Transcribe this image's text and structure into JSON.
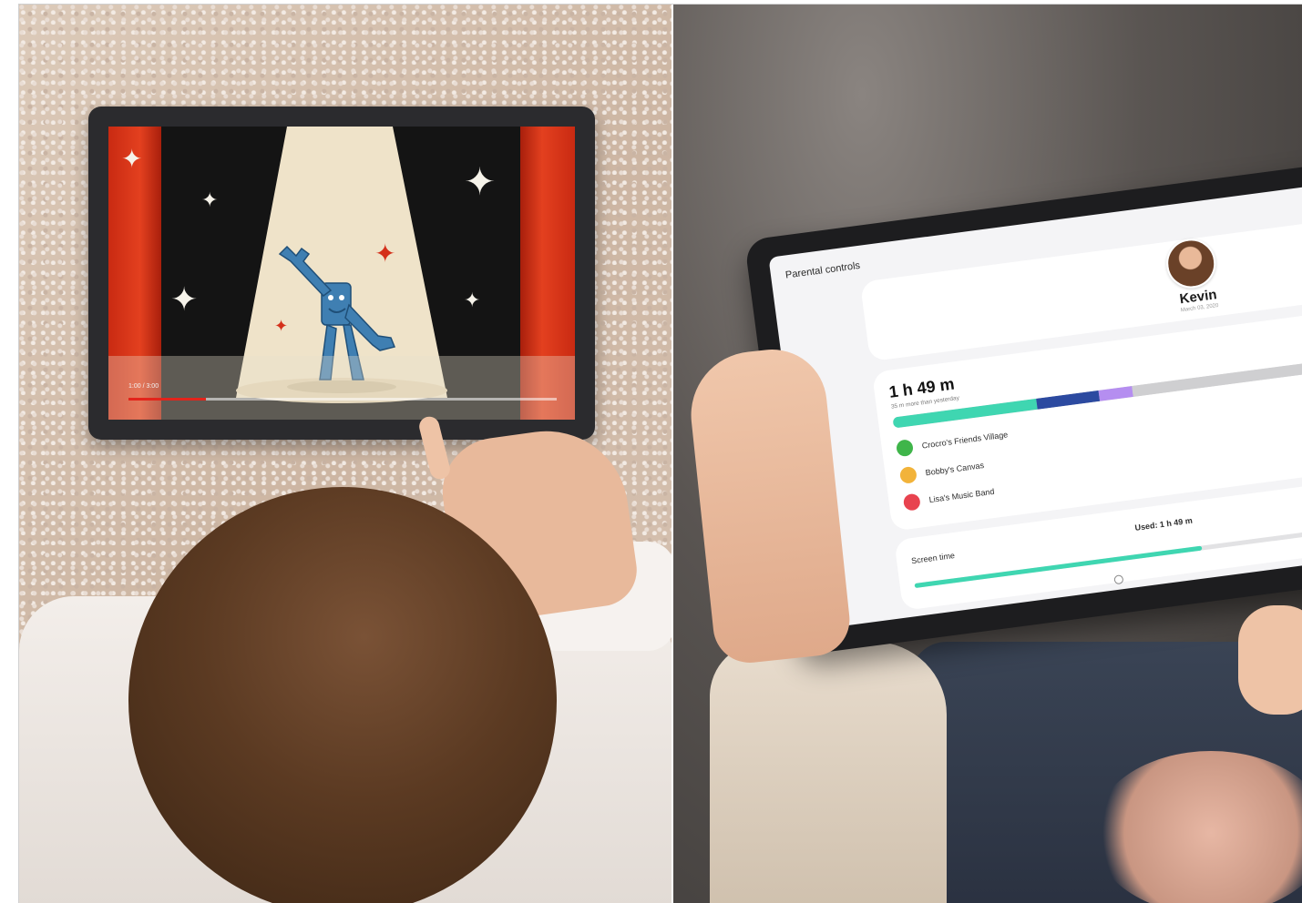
{
  "left_panel": {
    "video": {
      "time_label": "1:00 / 3:00",
      "progress_fraction": 0.18
    }
  },
  "right_panel": {
    "parental_controls": {
      "title": "Parental controls",
      "child": {
        "name": "Kevin",
        "date": "March 03, 2020"
      },
      "usage": {
        "total": "1 h 49 m",
        "comparison": "35 m more than yesterday",
        "segments": [
          {
            "fraction": 0.3,
            "color": "#3fd6b1"
          },
          {
            "fraction": 0.13,
            "color": "#2c4aa0"
          },
          {
            "fraction": 0.07,
            "color": "#b58ef0"
          },
          {
            "fraction": 0.5,
            "color": "#cfcfd1"
          }
        ],
        "apps": [
          {
            "name": "Crocro's Friends Village",
            "icon_color": "#3fb54a",
            "icon": "app-icon"
          },
          {
            "name": "Bobby's Canvas",
            "icon_color": "#f2b33a",
            "icon": "app-icon"
          },
          {
            "name": "Lisa's Music Band",
            "icon_color": "#e8434f",
            "icon": "app-icon"
          }
        ]
      },
      "screen_time": {
        "label": "Screen time",
        "used": "Used: 1 h 49 m",
        "fraction": 0.6
      }
    }
  }
}
